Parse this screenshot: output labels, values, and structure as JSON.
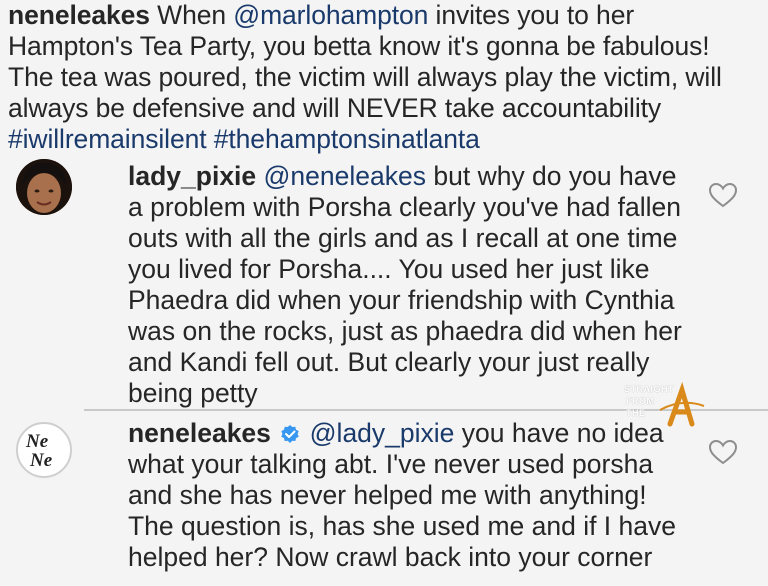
{
  "caption": {
    "username": "neneleakes",
    "text_1": "When ",
    "mention": "@marlohampton",
    "text_2": " invites you to her Hampton's Tea Party, you betta know it's gonna be fabulous! The tea was poured, the victim will always play the victim, will always be defensive and will NEVER take accountability ",
    "hashtag_1": "#iwillremainsilent",
    "hashtag_2": "#thehamptonsinatlanta"
  },
  "comments": [
    {
      "username": "lady_pixie",
      "mention": "@neneleakes",
      "text": " but why do you have a problem with Porsha clearly you've had fallen outs with all the girls and as I recall at one time you lived for Porsha.... You used her just like Phaedra did when your friendship with Cynthia was on the rocks, just as phaedra did when her and Kandi fell out. But clearly your just really being petty",
      "avatar_icon": "user-avatar-photo",
      "like_icon": "heart-outline-icon"
    },
    {
      "username": "neneleakes",
      "verified_icon": "verified-badge-icon",
      "mention": "@lady_pixie",
      "text": " you have no idea what your talking abt. I've never used porsha and she has never helped me with anything! The question is, has she used me and if I have helped her? Now crawl back into your corner",
      "avatar_logo": "NeNe",
      "like_icon": "heart-outline-icon"
    }
  ],
  "watermark": {
    "line1": "STRAIGHT",
    "line2": "FROM",
    "line3": "THE",
    "logo_letter": "A",
    "accent_color": "#d98a1a"
  },
  "colors": {
    "link": "#1a3a6b",
    "text": "#262626",
    "verified": "#3897f0",
    "background": "#f4f4f4"
  }
}
